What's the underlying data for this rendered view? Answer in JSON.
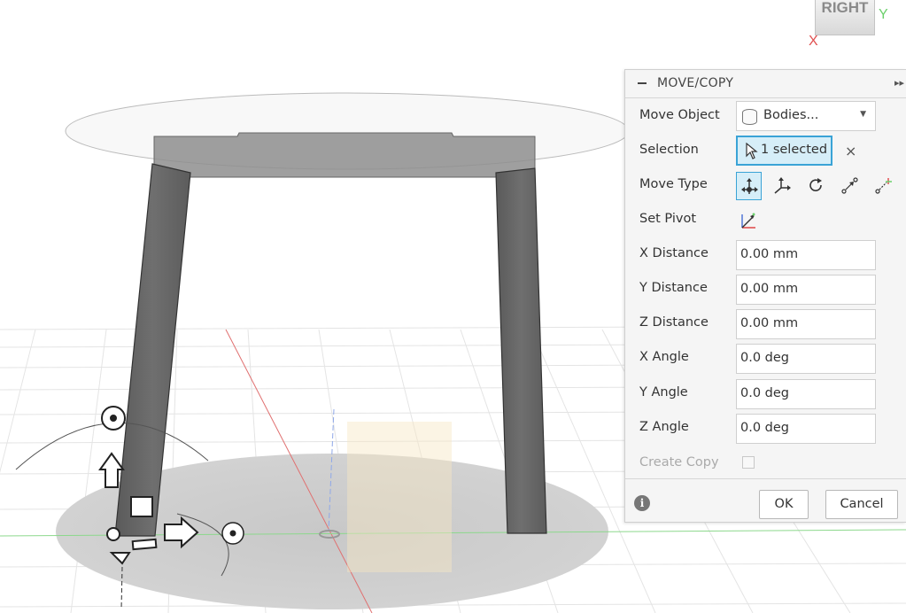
{
  "viewcube": {
    "face_label": "RIGHT",
    "axis_x": "X",
    "axis_y": "Y"
  },
  "panel": {
    "title": "MOVE/COPY",
    "rows": {
      "move_object": {
        "label": "Move Object",
        "value": "Bodies...",
        "icon": "bodies-cylinder-icon"
      },
      "selection": {
        "label": "Selection",
        "value": "1 selected",
        "clear_icon": "×"
      },
      "move_type": {
        "label": "Move Type",
        "options": [
          "free-move-icon",
          "translate-xyz-icon",
          "rotate-icon",
          "point-to-point-icon",
          "point-to-position-icon"
        ],
        "selected": "free-move-icon"
      },
      "set_pivot": {
        "label": "Set Pivot",
        "icon": "set-pivot-icon"
      },
      "x_distance": {
        "label": "X Distance",
        "value": "0.00 mm"
      },
      "y_distance": {
        "label": "Y Distance",
        "value": "0.00 mm"
      },
      "z_distance": {
        "label": "Z Distance",
        "value": "0.00 mm"
      },
      "x_angle": {
        "label": "X Angle",
        "value": "0.0 deg"
      },
      "y_angle": {
        "label": "Y Angle",
        "value": "0.0 deg"
      },
      "z_angle": {
        "label": "Z Angle",
        "value": "0.0 deg"
      },
      "create_copy": {
        "label": "Create Copy",
        "checked": false
      }
    },
    "footer": {
      "info_icon": "i",
      "ok_label": "OK",
      "cancel_label": "Cancel"
    }
  },
  "colors": {
    "accent": "#3aa3d6",
    "accent_bg": "#d6eef8",
    "axis_red": "#e05050",
    "axis_green": "#6cd06c",
    "model_gray": "#6a6a6a"
  }
}
